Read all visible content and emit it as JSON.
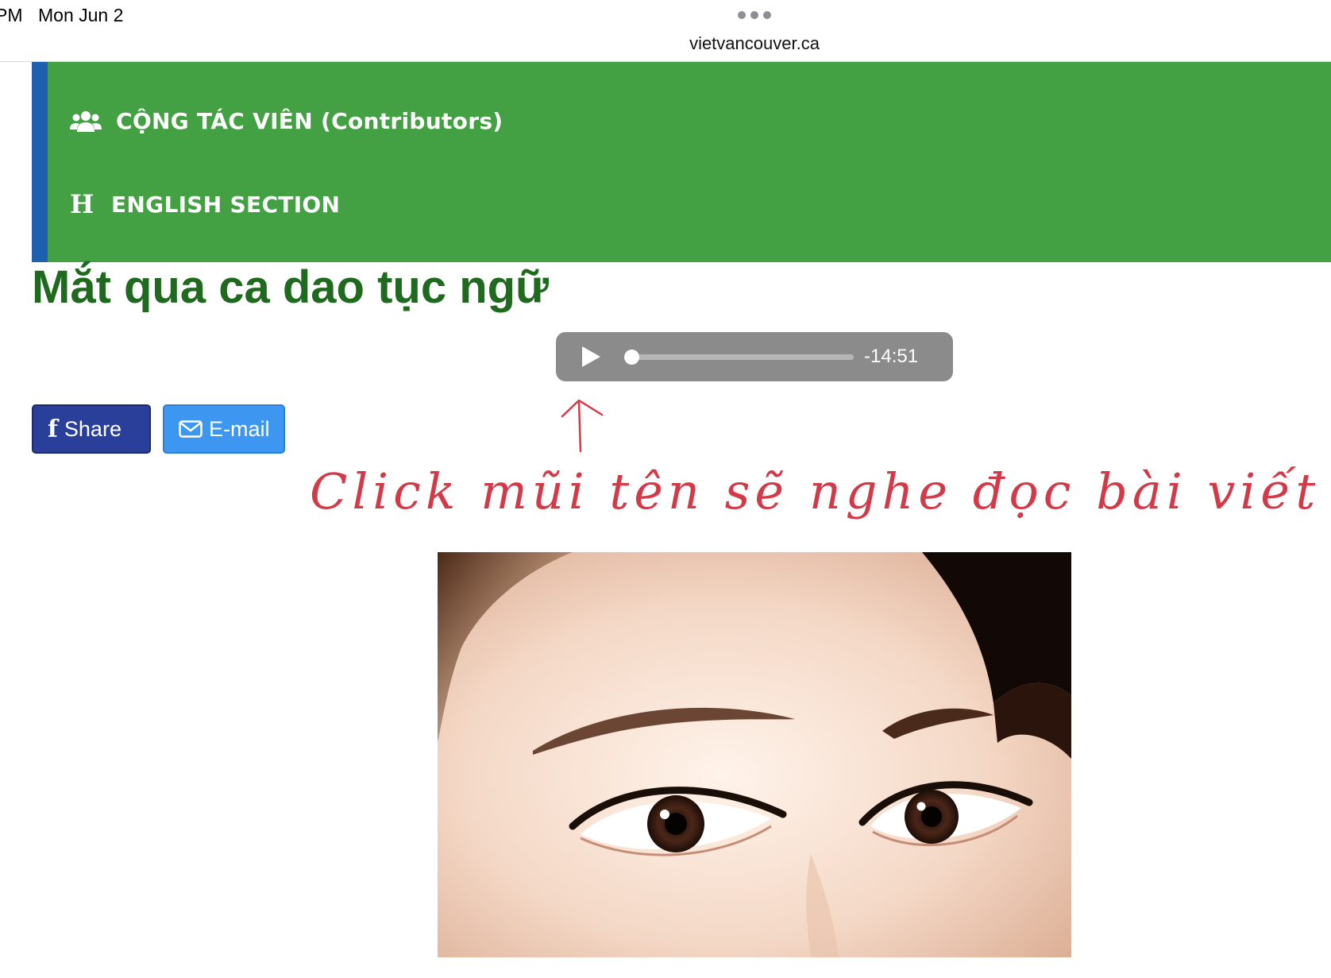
{
  "status_bar": {
    "time_fragment": "PM",
    "date": "Mon Jun 2",
    "url": "vietvancouver.ca"
  },
  "nav": {
    "items": [
      {
        "icon": "users-icon",
        "label": "CỘNG TÁC VIÊN (Contributors)"
      },
      {
        "icon": "h-icon",
        "icon_glyph": "H",
        "label": "ENGLISH SECTION"
      }
    ],
    "background": "#43a043",
    "accent": "#1f5fb0"
  },
  "article": {
    "title": "Mắt qua ca dao tục ngữ"
  },
  "player": {
    "remaining": "-14:51",
    "progress": 0
  },
  "share": {
    "facebook_icon": "f",
    "facebook_label": "Share",
    "email_label": "E-mail"
  },
  "annotation": {
    "text": "Click mũi tên sẽ nghe đọc bài viết",
    "color": "#d23a48"
  }
}
